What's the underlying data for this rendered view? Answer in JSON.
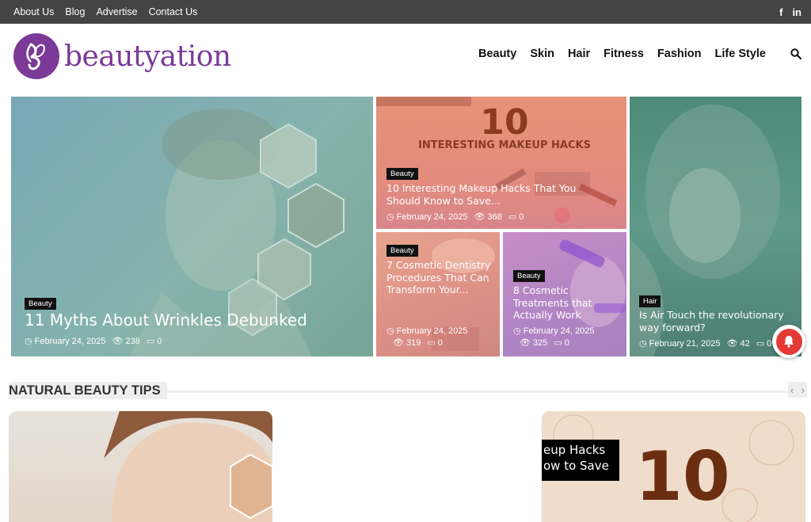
{
  "topbar": {
    "links": [
      "About Us",
      "Blog",
      "Advertise",
      "Contact Us"
    ],
    "social": [
      "f",
      "in"
    ]
  },
  "brand": {
    "name": "beautyation",
    "color": "#7b3a97"
  },
  "nav": {
    "items": [
      "Beauty",
      "Skin",
      "Hair",
      "Fitness",
      "Fashion",
      "Life Style"
    ],
    "search_icon": "search-icon"
  },
  "featured": [
    {
      "category": "Beauty",
      "title": "11 Myths About Wrinkles Debunked",
      "date": "February 24, 2025",
      "views": "238",
      "comments": "0"
    },
    {
      "category": "Beauty",
      "title": "10 Interesting Makeup Hacks That You Should Know to Save...",
      "date": "February 24, 2025",
      "views": "368",
      "comments": "0",
      "image_text": "10",
      "image_subtext": "INTERESTING MAKEUP HACKS"
    },
    {
      "category": "Beauty",
      "title": "7 Cosmetic Dentistry Procedures That Can Transform Your...",
      "date": "February 24, 2025",
      "views": "319",
      "comments": "0"
    },
    {
      "category": "Beauty",
      "title": "8 Cosmetic Treatments that Actually Work",
      "date": "February 24, 2025",
      "views": "325",
      "comments": "0"
    },
    {
      "category": "Hair",
      "title": "Is Air Touch the revolutionary way forward?",
      "date": "February 21, 2025",
      "views": "42",
      "comments": "0"
    }
  ],
  "section": {
    "title": "NATURAL BEAUTY TIPS",
    "prev": "‹",
    "next": "›"
  },
  "teaser": {
    "overlay_line1": "eup Hacks",
    "overlay_line2": "ow to Save",
    "number": "10"
  }
}
